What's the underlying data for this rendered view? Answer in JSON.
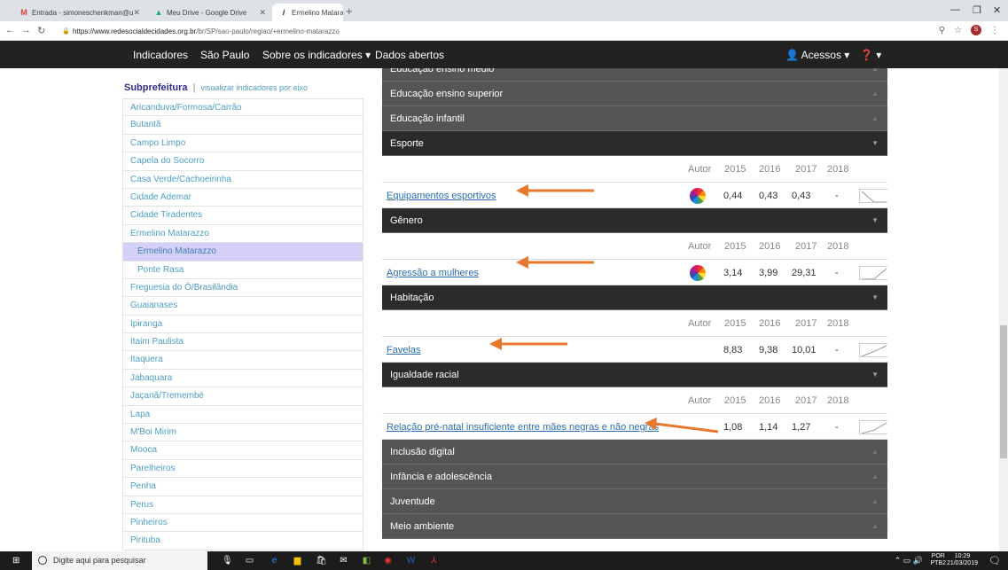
{
  "browser": {
    "tabs": [
      {
        "title": "Entrada - simoneschenkman@u",
        "icon": "gmail-icon"
      },
      {
        "title": "Meu Drive - Google Drive",
        "icon": "drive-icon"
      },
      {
        "title": "Ermelino Matarazzo - São Paulo",
        "icon": "site-icon"
      }
    ],
    "url_domain": "https://www.redesocialdecidades.org.br",
    "url_path": "/br/SP/sao-paulo/regiao/+ermelino-matarazzo",
    "profile_initial": "S"
  },
  "nav": {
    "indicadores": "Indicadores",
    "sao_paulo": "São Paulo",
    "sobre": "Sobre os indicadores ▾",
    "dados": "Dados abertos",
    "acessos": "Acessos ▾",
    "help": "▾"
  },
  "sidebar": {
    "title": "Subprefeitura",
    "separator": "|",
    "link": "visualizar indicadores por eixo",
    "items": [
      {
        "label": "Aricanduva/Formosa/Carrão",
        "level": 0,
        "selected": false
      },
      {
        "label": "Butantã",
        "level": 0,
        "selected": false
      },
      {
        "label": "Campo Limpo",
        "level": 0,
        "selected": false
      },
      {
        "label": "Capela do Socorro",
        "level": 0,
        "selected": false
      },
      {
        "label": "Casa Verde/Cachoeirinha",
        "level": 0,
        "selected": false
      },
      {
        "label": "Cidade Ademar",
        "level": 0,
        "selected": false
      },
      {
        "label": "Cidade Tiradentes",
        "level": 0,
        "selected": false
      },
      {
        "label": "Ermelino Matarazzo",
        "level": 0,
        "selected": false
      },
      {
        "label": "Ermelino Matarazzo",
        "level": 1,
        "selected": true
      },
      {
        "label": "Ponte Rasa",
        "level": 1,
        "selected": false
      },
      {
        "label": "Freguesia do Ó/Brasilândia",
        "level": 0,
        "selected": false
      },
      {
        "label": "Guaianases",
        "level": 0,
        "selected": false
      },
      {
        "label": "Ipiranga",
        "level": 0,
        "selected": false
      },
      {
        "label": "Itaim Paulista",
        "level": 0,
        "selected": false
      },
      {
        "label": "Itaquera",
        "level": 0,
        "selected": false
      },
      {
        "label": "Jabaquara",
        "level": 0,
        "selected": false
      },
      {
        "label": "Jaçanã/Tremembé",
        "level": 0,
        "selected": false
      },
      {
        "label": "Lapa",
        "level": 0,
        "selected": false
      },
      {
        "label": "M'Boi Mirim",
        "level": 0,
        "selected": false
      },
      {
        "label": "Mooca",
        "level": 0,
        "selected": false
      },
      {
        "label": "Parelheiros",
        "level": 0,
        "selected": false
      },
      {
        "label": "Penha",
        "level": 0,
        "selected": false
      },
      {
        "label": "Perus",
        "level": 0,
        "selected": false
      },
      {
        "label": "Pinheiros",
        "level": 0,
        "selected": false
      },
      {
        "label": "Pirituba",
        "level": 0,
        "selected": false
      }
    ]
  },
  "table_header": {
    "autor": "Autor",
    "y2015": "2015",
    "y2016": "2016",
    "y2017": "2017",
    "y2018": "2018"
  },
  "categories": [
    {
      "label": "Educação ensino médio",
      "open": false
    },
    {
      "label": "Educação ensino superior",
      "open": false
    },
    {
      "label": "Educação infantil",
      "open": false
    },
    {
      "label": "Esporte",
      "open": true,
      "indicator": {
        "name": "Equipamentos esportivos",
        "has_autor": true,
        "v2015": "0,44",
        "v2016": "0,43",
        "v2017": "0,43",
        "v2018": "-"
      }
    },
    {
      "label": "Gênero",
      "open": true,
      "indicator": {
        "name": "Agressão a mulheres",
        "has_autor": true,
        "v2015": "3,14",
        "v2016": "3,99",
        "v2017": "29,31",
        "v2018": "-"
      }
    },
    {
      "label": "Habitação",
      "open": true,
      "indicator": {
        "name": "Favelas",
        "has_autor": false,
        "v2015": "8,83",
        "v2016": "9,38",
        "v2017": "10,01",
        "v2018": "-"
      }
    },
    {
      "label": "Igualdade racial",
      "open": true,
      "indicator": {
        "name": "Relação pré-natal insuficiente entre mães negras e não negras",
        "has_autor": false,
        "v2015": "1,08",
        "v2016": "1,14",
        "v2017": "1,27",
        "v2018": "-"
      }
    },
    {
      "label": "Inclusão digital",
      "open": false
    },
    {
      "label": "Infância e adolescência",
      "open": false
    },
    {
      "label": "Juventude",
      "open": false
    },
    {
      "label": "Meio ambiente",
      "open": false
    }
  ],
  "taskbar": {
    "search_placeholder": "Digite aqui para pesquisar",
    "lang": "POR",
    "lang2": "PTB2",
    "time": "10:29",
    "date": "21/03/2019"
  },
  "colors": {
    "arrow": "#e8782e",
    "link": "#4d9ec2",
    "nav_bg": "#222222",
    "cat_bg": "#555555",
    "cat_open_bg": "#2b2b2b"
  }
}
